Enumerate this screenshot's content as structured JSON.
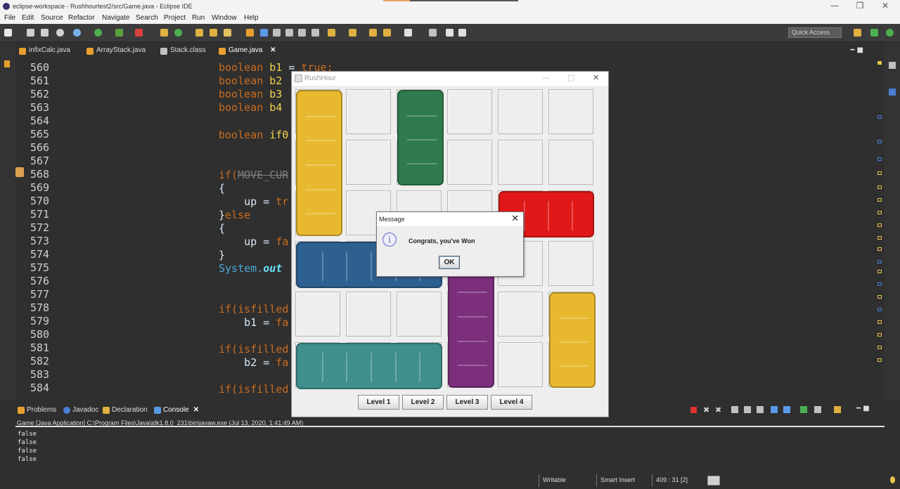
{
  "window": {
    "title": "eclipse-workspace - Rushhourtest2/src/Game.java - Eclipse IDE"
  },
  "menu": [
    "File",
    "Edit",
    "Source",
    "Refactor",
    "Navigate",
    "Search",
    "Project",
    "Run",
    "Window",
    "Help"
  ],
  "toolbar": {
    "quick_access": "Quick Access"
  },
  "tabs": [
    {
      "label": "infixCalc.java",
      "icon": "java-file-icon"
    },
    {
      "label": "ArrayStack.java",
      "icon": "java-file-icon"
    },
    {
      "label": "Stack.class",
      "icon": "class-file-icon"
    },
    {
      "label": "Game.java",
      "icon": "java-file-icon",
      "active": true
    }
  ],
  "editor": {
    "line_numbers": [
      "560",
      "561",
      "562",
      "563",
      "564",
      "565",
      "566",
      "567",
      "568",
      "569",
      "570",
      "571",
      "572",
      "573",
      "574",
      "575",
      "576",
      "577",
      "578",
      "579",
      "580",
      "581",
      "582",
      "583",
      "584"
    ],
    "lines": {
      "l560a": "boolean ",
      "l560b": "b1",
      "l560c": " = ",
      "l560d": "true;",
      "l561a": "boolean ",
      "l561b": "b2",
      "l562a": "boolean ",
      "l562b": "b3",
      "l563a": "boolean ",
      "l563b": "b4",
      "l565a": "boolean ",
      "l565b": "if0",
      "l568a": "if(",
      "l568b": "MOVE_CUR",
      "l569": "{",
      "l570a": "    up = ",
      "l570b": "tr",
      "l571a": "}",
      "l571b": "else",
      "l572": "{",
      "l573a": "    up = ",
      "l573b": "fa",
      "l574": "}",
      "l575a": "System.",
      "l575b": "out",
      "l578": "if(isfilled",
      "l579a": "    b1 = ",
      "l579b": "fa",
      "l581": "if(isfilled",
      "l582a": "    b2 = ",
      "l582b": "fa",
      "l584": "if(isfilled"
    }
  },
  "game": {
    "title": "RushHour",
    "levels": [
      "Level 1",
      "Level 2",
      "Level 3",
      "Level 4"
    ],
    "cars": [
      {
        "name": "yellow-truck-vertical",
        "color": "#e8b92f",
        "col": 1,
        "row": 1,
        "len": 3,
        "dir": "v"
      },
      {
        "name": "green-car-vertical",
        "color": "#2f7a4e",
        "col": 3,
        "row": 1,
        "len": 2,
        "dir": "v"
      },
      {
        "name": "red-car-horizontal",
        "color": "#e01818",
        "col": 5,
        "row": 3,
        "len": 2,
        "dir": "h"
      },
      {
        "name": "blue-truck-horizontal",
        "color": "#2d5f8f",
        "col": 1,
        "row": 4,
        "len": 3,
        "dir": "h"
      },
      {
        "name": "purple-truck-vertical",
        "color": "#7b2f7c",
        "col": 4,
        "row": 4,
        "len": 3,
        "dir": "v"
      },
      {
        "name": "yellow-car-vertical",
        "color": "#e8b92f",
        "col": 6,
        "row": 5,
        "len": 2,
        "dir": "v"
      },
      {
        "name": "teal-truck-horizontal",
        "color": "#3f8f8c",
        "col": 1,
        "row": 6,
        "len": 3,
        "dir": "h"
      }
    ]
  },
  "dialog": {
    "title": "Message",
    "text": "Congrats, you've Won",
    "ok": "OK"
  },
  "console": {
    "tabs": [
      "Problems",
      "Javadoc",
      "Declaration",
      "Console"
    ],
    "header": "Game [Java Application] C:\\Program Files\\Java\\jdk1.8.0_231\\bin\\javaw.exe (Jul 13, 2020, 1:41:49 AM)",
    "output": [
      "false",
      "false",
      "false",
      "false"
    ]
  },
  "status": {
    "writable": "Writable",
    "insert": "Smart Insert",
    "position": "409 : 31 [2]"
  }
}
